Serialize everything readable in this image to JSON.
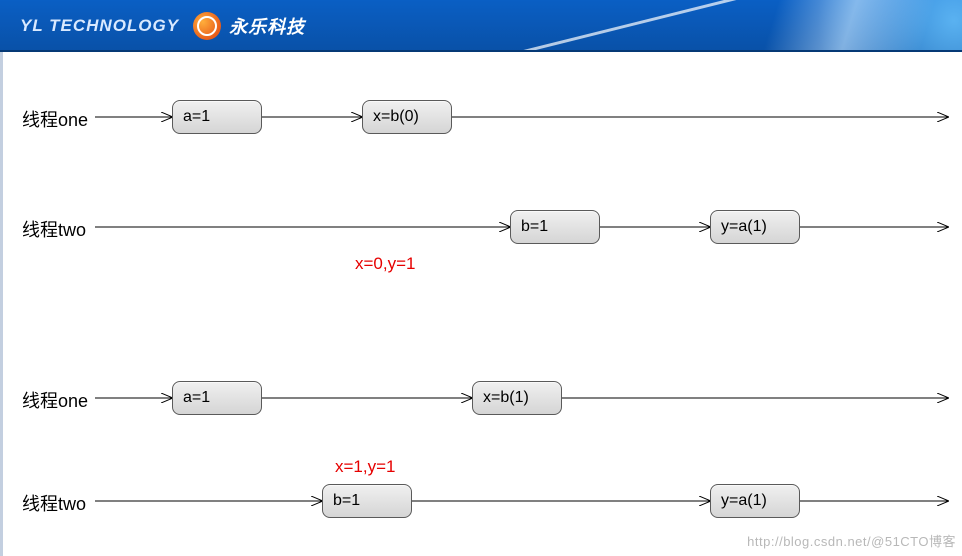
{
  "header": {
    "brand_en": "YL TECHNOLOGY",
    "brand_cn": "永乐科技"
  },
  "scenarios": [
    {
      "rows": [
        {
          "label": "线程one",
          "ops": [
            "a=1",
            "x=b(0)"
          ]
        },
        {
          "label": "线程two",
          "ops": [
            "b=1",
            "y=a(1)"
          ]
        }
      ],
      "result": "x=0,y=1"
    },
    {
      "rows": [
        {
          "label": "线程one",
          "ops": [
            "a=1",
            "x=b(1)"
          ]
        },
        {
          "label": "线程two",
          "ops": [
            "b=1",
            "y=a(1)"
          ]
        }
      ],
      "result": "x=1,y=1"
    }
  ],
  "watermark": "http://blog.csdn.net/@51CTO博客"
}
